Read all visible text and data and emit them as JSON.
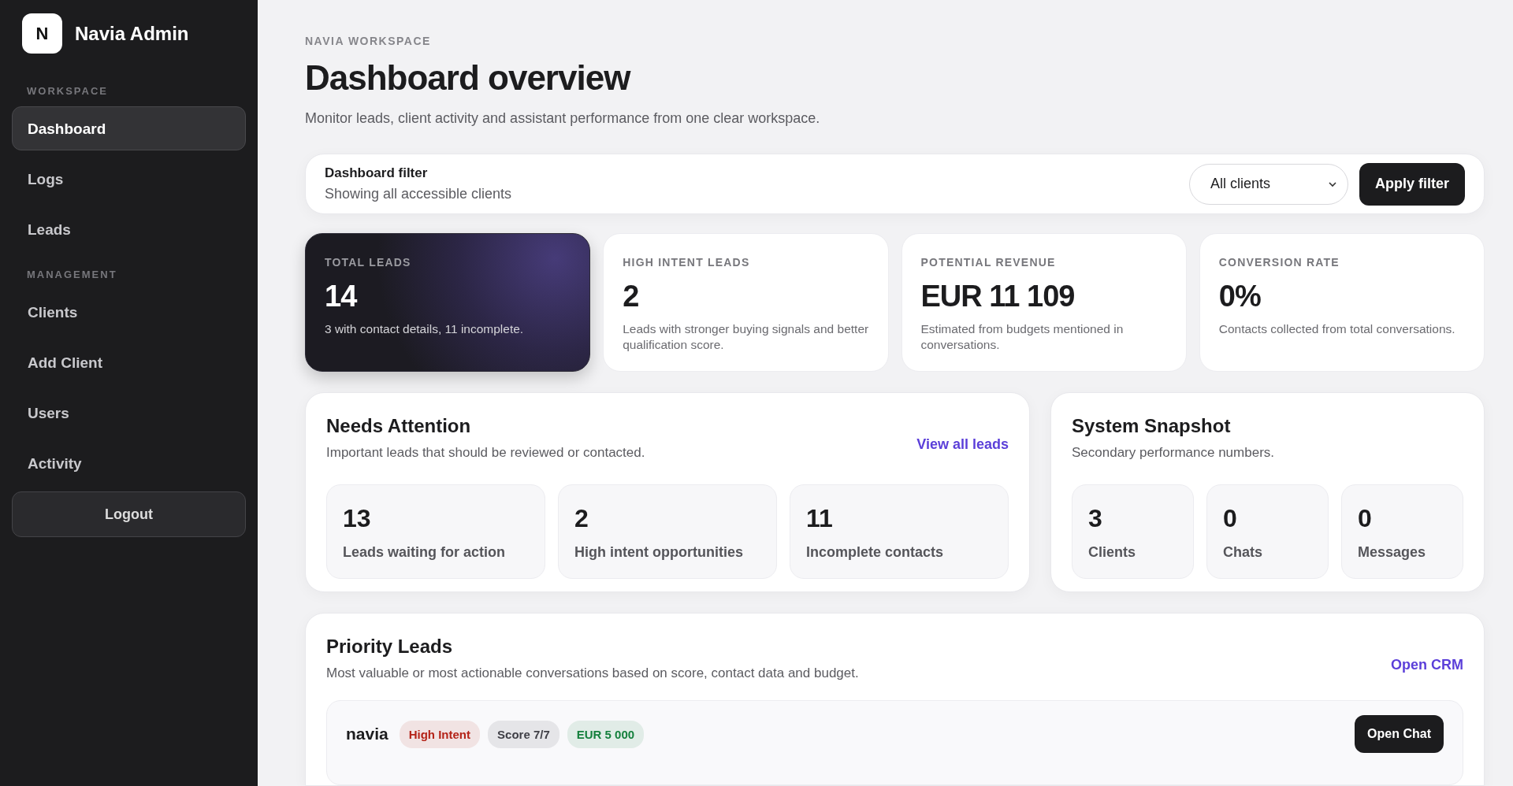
{
  "brand": {
    "logo": "N",
    "name": "Navia Admin"
  },
  "sidebar": {
    "sections": [
      {
        "title": "WORKSPACE",
        "items": [
          {
            "label": "Dashboard",
            "selected": true
          },
          {
            "label": "Logs",
            "selected": false
          },
          {
            "label": "Leads",
            "selected": false
          }
        ]
      },
      {
        "title": "MANAGEMENT",
        "items": [
          {
            "label": "Clients",
            "selected": false
          },
          {
            "label": "Add Client",
            "selected": false
          },
          {
            "label": "Users",
            "selected": false
          },
          {
            "label": "Activity",
            "selected": false
          }
        ]
      }
    ],
    "logout": "Logout"
  },
  "header": {
    "eyebrow": "NAVIA WORKSPACE",
    "title": "Dashboard overview",
    "subtitle": "Monitor leads, client activity and assistant performance from one clear workspace."
  },
  "filter": {
    "title": "Dashboard filter",
    "subtitle": "Showing all accessible clients",
    "select": "All clients",
    "button": "Apply filter"
  },
  "stats": [
    {
      "label": "TOTAL LEADS",
      "value": "14",
      "note": "3 with contact details, 11 incomplete.",
      "kind": "dark"
    },
    {
      "label": "HIGH INTENT LEADS",
      "value": "2",
      "note": "Leads with stronger buying signals and better qualification score.",
      "kind": "light"
    },
    {
      "label": "POTENTIAL REVENUE",
      "value": "EUR 11 109",
      "note": "Estimated from budgets mentioned in conversations.",
      "kind": "light"
    },
    {
      "label": "CONVERSION RATE",
      "value": "0%",
      "note": "Contacts collected from total conversations.",
      "kind": "light"
    }
  ],
  "needs_attention": {
    "title": "Needs Attention",
    "subtitle": "Important leads that should be reviewed or contacted.",
    "link": "View all leads",
    "tiles": [
      {
        "value": "13",
        "label": "Leads waiting for action"
      },
      {
        "value": "2",
        "label": "High intent opportunities"
      },
      {
        "value": "11",
        "label": "Incomplete contacts"
      }
    ]
  },
  "system_snapshot": {
    "title": "System Snapshot",
    "subtitle": "Secondary performance numbers.",
    "tiles": [
      {
        "value": "3",
        "label": "Clients"
      },
      {
        "value": "0",
        "label": "Chats"
      },
      {
        "value": "0",
        "label": "Messages"
      }
    ]
  },
  "priority_leads": {
    "title": "Priority Leads",
    "subtitle": "Most valuable or most actionable conversations based on score, contact data and budget.",
    "link": "Open CRM",
    "leads": [
      {
        "name": "navia",
        "tags": [
          {
            "label": "High Intent",
            "color": "#b42318"
          },
          {
            "label": "Score 7/7",
            "color": "#3f3f46"
          },
          {
            "label": "EUR 5 000",
            "color": "#15803d"
          }
        ],
        "button": "Open Chat"
      }
    ]
  }
}
